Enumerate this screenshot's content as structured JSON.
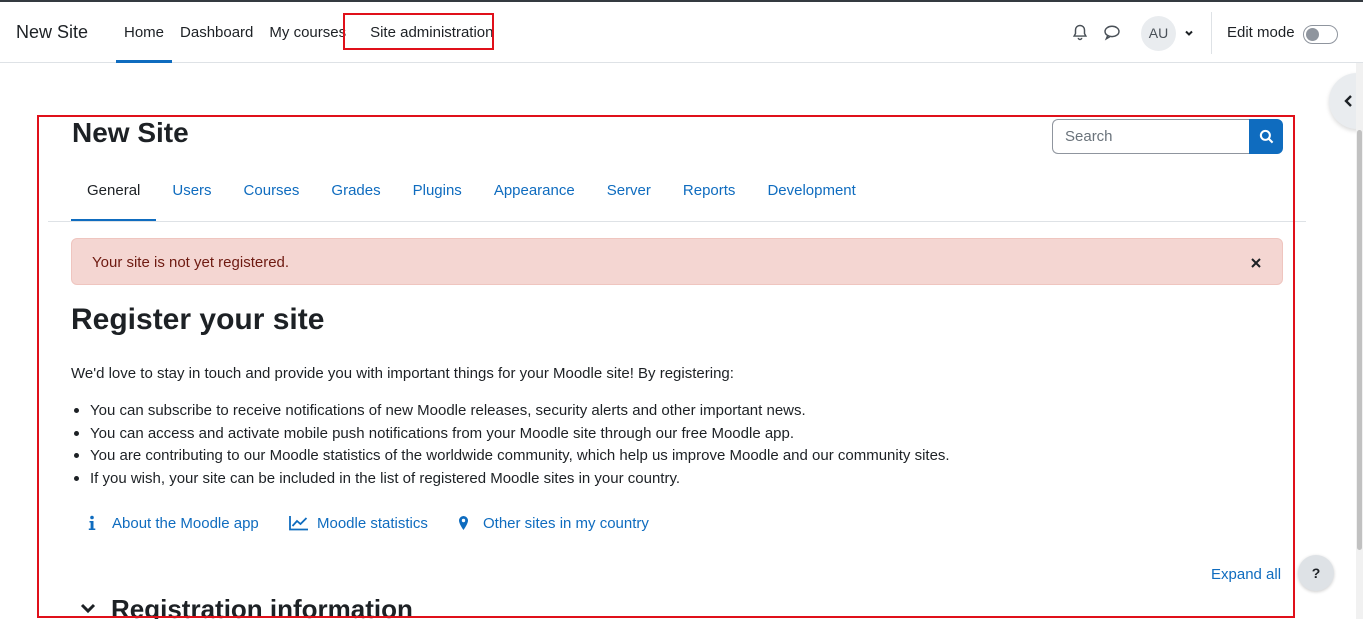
{
  "navbar": {
    "brand": "New Site",
    "items": [
      {
        "label": "Home",
        "active": true
      },
      {
        "label": "Dashboard",
        "active": false
      },
      {
        "label": "My courses",
        "active": false
      },
      {
        "label": "Site administration",
        "active": false
      }
    ],
    "avatar_initials": "AU",
    "edit_mode_label": "Edit mode",
    "edit_mode_on": false
  },
  "page": {
    "title": "New Site",
    "search_placeholder": "Search"
  },
  "secondary_tabs": [
    {
      "label": "General",
      "active": true
    },
    {
      "label": "Users",
      "active": false
    },
    {
      "label": "Courses",
      "active": false
    },
    {
      "label": "Grades",
      "active": false
    },
    {
      "label": "Plugins",
      "active": false
    },
    {
      "label": "Appearance",
      "active": false
    },
    {
      "label": "Server",
      "active": false
    },
    {
      "label": "Reports",
      "active": false
    },
    {
      "label": "Development",
      "active": false
    }
  ],
  "alert": {
    "text": "Your site is not yet registered."
  },
  "register": {
    "heading": "Register your site",
    "intro": "We'd love to stay in touch and provide you with important things for your Moodle site! By registering:",
    "bullets": [
      "You can subscribe to receive notifications of new Moodle releases, security alerts and other important news.",
      "You can access and activate mobile push notifications from your Moodle site through our free Moodle app.",
      "You are contributing to our Moodle statistics of the worldwide community, which help us improve Moodle and our community sites.",
      "If you wish, your site can be included in the list of registered Moodle sites in your country."
    ],
    "links": [
      {
        "label": "About the Moodle app",
        "icon": "info-icon"
      },
      {
        "label": "Moodle statistics",
        "icon": "line-chart-icon"
      },
      {
        "label": "Other sites in my country",
        "icon": "map-marker-icon"
      }
    ],
    "expand_all": "Expand all",
    "section_title": "Registration information"
  },
  "help_label": "?",
  "colors": {
    "primary": "#0f6cbf",
    "alert_bg": "#f4d6d2",
    "alert_text": "#6e1a11",
    "highlight": "#e0101a"
  }
}
